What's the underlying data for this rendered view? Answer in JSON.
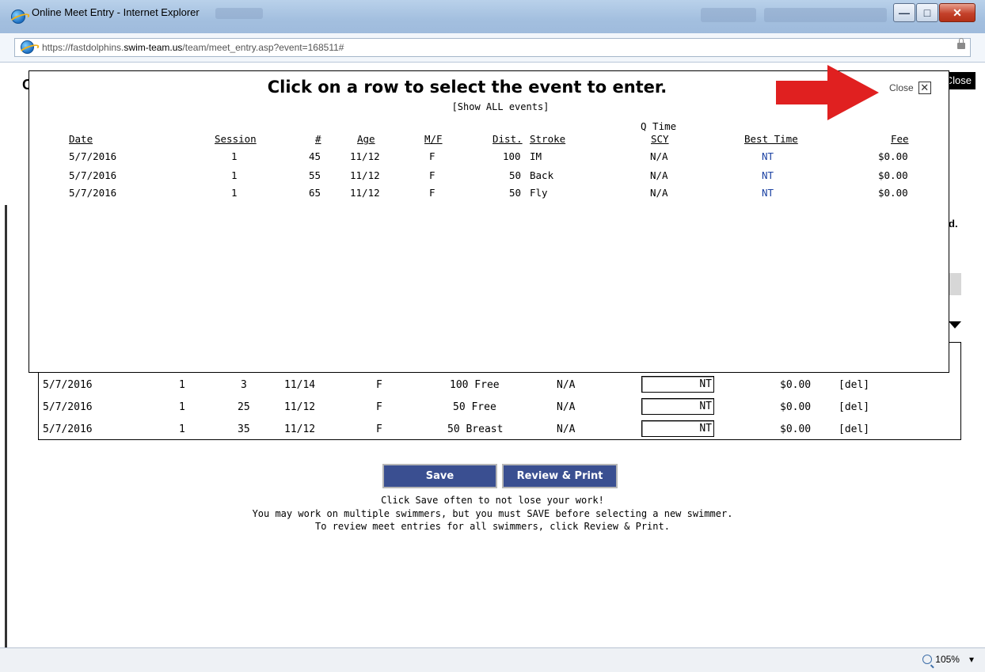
{
  "window": {
    "title": "Online Meet Entry - Internet Explorer",
    "buttons": {
      "minimize": "—",
      "maximize": "□",
      "close": "✕"
    }
  },
  "address": {
    "url_prefix": "https://fastdolphins.",
    "url_domain": "swim-team.us",
    "url_path": "/team/meet_entry.asp?event=168511#"
  },
  "background": {
    "partial_header": "O",
    "partial_d": "d.",
    "close_label": "Close",
    "entries": [
      {
        "date": "5/7/2016",
        "session": "1",
        "num": "3",
        "age": "11/14",
        "mf": "F",
        "event": "100 Free",
        "qtime": "N/A",
        "time": "NT",
        "fee": "$0.00",
        "del": "[del]"
      },
      {
        "date": "5/7/2016",
        "session": "1",
        "num": "25",
        "age": "11/12",
        "mf": "F",
        "event": "50 Free",
        "qtime": "N/A",
        "time": "NT",
        "fee": "$0.00",
        "del": "[del]"
      },
      {
        "date": "5/7/2016",
        "session": "1",
        "num": "35",
        "age": "11/12",
        "mf": "F",
        "event": "50 Breast",
        "qtime": "N/A",
        "time": "NT",
        "fee": "$0.00",
        "del": "[del]"
      }
    ],
    "save_label": "Save",
    "review_label": "Review & Print",
    "help_lines": [
      "Click Save often to not lose your work!",
      "You may work on multiple swimmers, but you must SAVE before selecting a new swimmer.",
      "To review meet entries for all swimmers, click Review & Print."
    ]
  },
  "modal": {
    "title": "Click on a row to select the event to enter.",
    "show_all": "[Show ALL events]",
    "close_label": "Close",
    "close_icon": "✕",
    "headers": {
      "date": "Date",
      "session": "Session",
      "num": "#",
      "age": "Age",
      "mf": "M/F",
      "dist": "Dist.",
      "stroke": "Stroke",
      "qtime_top": "Q Time",
      "qtime": "SCY",
      "best": "Best Time",
      "fee": "Fee"
    },
    "rows": [
      {
        "date": "5/7/2016",
        "session": "1",
        "num": "45",
        "age": "11/12",
        "mf": "F",
        "dist": "100",
        "stroke": "IM",
        "qtime": "N/A",
        "best": "NT",
        "fee": "$0.00"
      },
      {
        "date": "5/7/2016",
        "session": "1",
        "num": "55",
        "age": "11/12",
        "mf": "F",
        "dist": "50",
        "stroke": "Back",
        "qtime": "N/A",
        "best": "NT",
        "fee": "$0.00"
      },
      {
        "date": "5/7/2016",
        "session": "1",
        "num": "65",
        "age": "11/12",
        "mf": "F",
        "dist": "50",
        "stroke": "Fly",
        "qtime": "N/A",
        "best": "NT",
        "fee": "$0.00"
      }
    ]
  },
  "status": {
    "zoom": "105%",
    "zoom_caret": "▾"
  },
  "colors": {
    "button_bg": "#3a4f91",
    "link_blue": "#1d43a3",
    "arrow_red": "#e02020"
  }
}
